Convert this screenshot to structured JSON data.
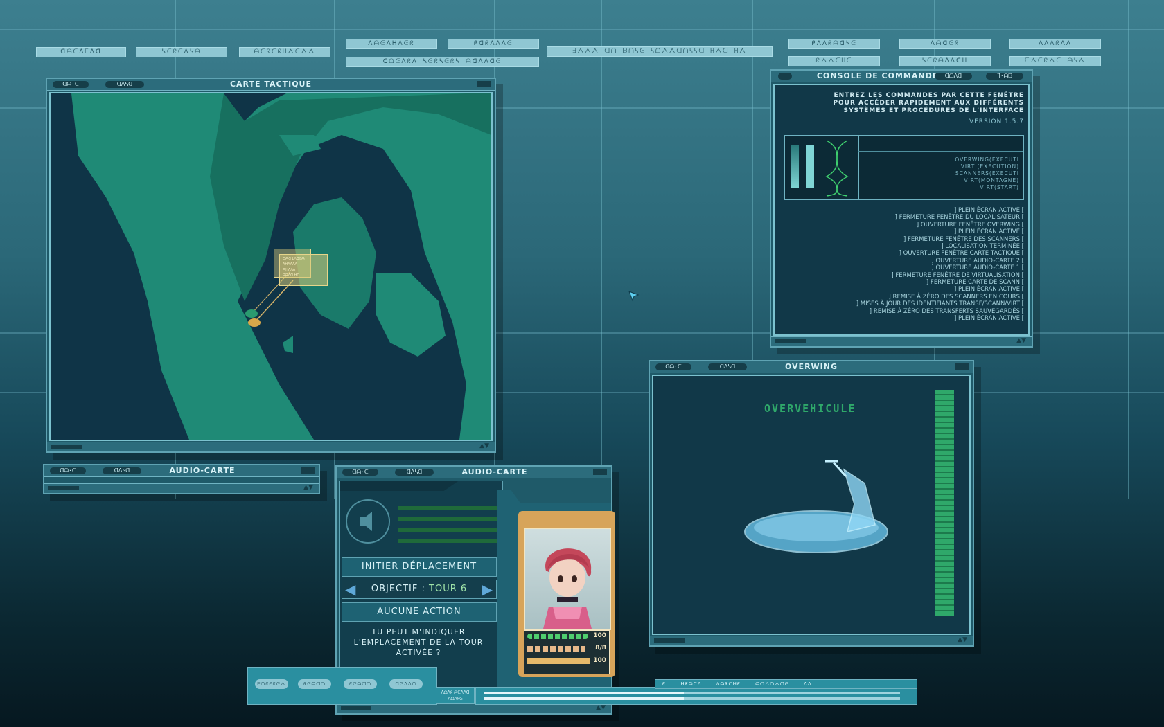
{
  "top_buttons": [
    {
      "label": "ᗡᗩᕮᐱᖴᐱᗡ"
    },
    {
      "label": "ᓴᕮᖇᕮᐱᓴᗩ"
    },
    {
      "label": "ᗩᕮᖇᕮᖇᕼᐱᕮᐱᐱ"
    },
    {
      "label": "ᐱᗩᕮᐱᕼᐱᕮᖇ"
    },
    {
      "label": "ᑭᗡᖇᐱᐱᐱᕮ"
    },
    {
      "label": "ᑕᗝᕮᐱᖇᐱ ᓴᕮᖇᓴᕮᖇᓴ ᗩᗡᐱᐱᗡᕮ"
    },
    {
      "label": "ᖵᐱᐱᐱ ᗡᗩ ᗷᗩᓴᕮ ᓴᗝᐱᐱᗡᗩᓴᓴᗡ ᕼᐱᗡ ᕼᐱ"
    },
    {
      "label": "ᑭᐱᐱᖇᗩᗡᓴᕮ"
    },
    {
      "label": "ᐱᗩᗡᕮᖇ"
    },
    {
      "label": "ᐱᐱᐱᖇᐱᐱ"
    },
    {
      "label": "ᖇᐱᐱᑕᕼᕮ"
    },
    {
      "label": "ᓴᕮᖇᗩᐱᐱᑕᕼ"
    },
    {
      "label": "ᗴᐱᕮᖇᐱᕮ ᗩᓴᐱ"
    }
  ],
  "tactical": {
    "title": "CARTE TACTIQUE",
    "pill1": "ᗡᗩ·ᑕ",
    "pill2": "ᗡᐱᓴᗡ",
    "tooltip_lines": [
      "ᗝᗩᕮ ᒪᐱᗡᕮᗩ",
      "ᐱᕼᐱᐱᐱᐱ",
      "ᗩᕼᐱᐱᐱ",
      "ᗷᗩᐱᗡ ᕼᗡ"
    ]
  },
  "console": {
    "title": "CONSOLE DE COMMANDES",
    "pill1": "ᗡᗝᐱᗡ",
    "pill2": "ᒣ·ᗩᗷ",
    "intro": [
      "ENTREZ LES COMMANDES PAR CETTE FENÊTRE",
      "POUR ACCÉDER RAPIDEMENT AUX DIFFÉRENTS",
      "SYSTÈMES ET PROCÉDURES DE L'INTERFACE"
    ],
    "version": "VERSION 1.5.7",
    "status": [
      "OVERWING(EXECUTI",
      "VIRTI(EXECUTION)",
      "SCANNERS(EXECUTI",
      "VIRT(MONTAGNE)",
      "VIRT(START)"
    ],
    "log": [
      "] PLEIN ÉCRAN ACTIVÉ [",
      "] FERMETURE FENÊTRE DU LOCALISATEUR [",
      "] OUVERTURE FENÊTRE OVERWING [",
      "] PLEIN ÉCRAN ACTIVÉ [",
      "] FERMETURE FENÊTRE DES SCANNERS [",
      "] LOCALISATION TERMINÉE [",
      "] OUVERTURE FENÊTRE CARTE TACTIQUE [",
      "] OUVERTURE AUDIO-CARTE 2 [",
      "] OUVERTURE AUDIO-CARTE 1 [",
      "] FERMETURE FENÊTRE DE VIRTUALISATION [",
      "] FERMETURE CARTE DE SCANN [",
      "] PLEIN ÉCRAN ACTIVÉ [",
      "] REMISE À ZÉRO DES SCANNERS EN COURS [",
      "] MISES À JOUR DES IDENTIFIANTS TRANSF/SCANN/VIRT [",
      "] REMISE À ZÉRO DES TRANSFERTS SAUVEGARDÉS [",
      "] PLEIN ÉCRAN ACTIVÉ ["
    ]
  },
  "overwing": {
    "title": "OVERWING",
    "pill1": "ᗡᗩ·ᑕ",
    "pill2": "ᗡᐱᓴᗡ",
    "heading": "OVERVEHICULE"
  },
  "audio_small": {
    "title": "AUDIO-CARTE",
    "pill1": "ᗡᗩ·ᑕ",
    "pill2": "ᗡᐱᓴᗡ"
  },
  "audio_main": {
    "title": "AUDIO-CARTE",
    "pill1": "ᗡᗩ·ᑕ",
    "pill2": "ᗡᐱᓴᗡ",
    "move_button": "INITIER DÉPLACEMENT",
    "objective_label": "OBJECTIF :",
    "objective_value": "TOUR 6",
    "no_action": "AUCUNE ACTION",
    "message": [
      "TU PEUT M'INDIQUER",
      "L'EMPLACEMENT DE LA TOUR",
      "ACTIVÉE ?"
    ],
    "stat1": "100",
    "stat2": "8/8",
    "stat3": "100"
  },
  "bottom_panel": {
    "chips": [
      "ᖴᗝᖇᑭᖇᕮᐱ",
      "ᖇᕮᗩᗡᗝ",
      "ᖇᕮᗩᗡᗝ",
      "ᗡᕮᐱᐱᗝ"
    ],
    "tower_label": "ᐱᗝᐱᖇ ᗩᑕᐱᐱᗡ ᐱᗝᐱᖇᕮ",
    "status_items": [
      "ᖇ",
      "ᕼᖇᗩᑕᐱ",
      "ᐱᗩᖇᑕᕼᖇ",
      "ᗩᗡᐱᗝᐱᗡᕮ",
      "ᐱᐱ"
    ]
  },
  "colors": {
    "accent": "#5fa3b3",
    "land": "#1f8a76",
    "gold": "#d7b56a"
  }
}
